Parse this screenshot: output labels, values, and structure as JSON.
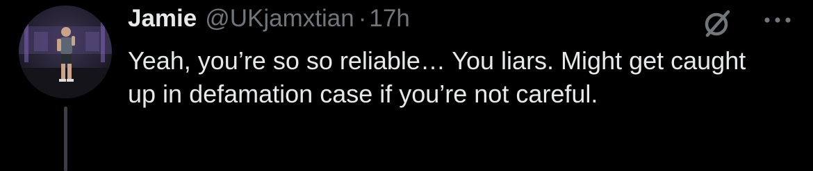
{
  "tweet": {
    "author_name": "Jamie",
    "handle": "@UKjamxtian",
    "separator": "·",
    "time": "17h",
    "text": "Yeah, you’re so so reliable… You liars. Might get caught up in defamation case if you’re not careful."
  },
  "icons": {
    "avatar": "avatar-gym-photo",
    "grok": "grok-icon",
    "more": "more-horizontal-icon"
  },
  "colors": {
    "background": "#000000",
    "primary_text": "#e7e9ea",
    "secondary_text": "#71767b",
    "thread_line": "#3a3d42"
  }
}
